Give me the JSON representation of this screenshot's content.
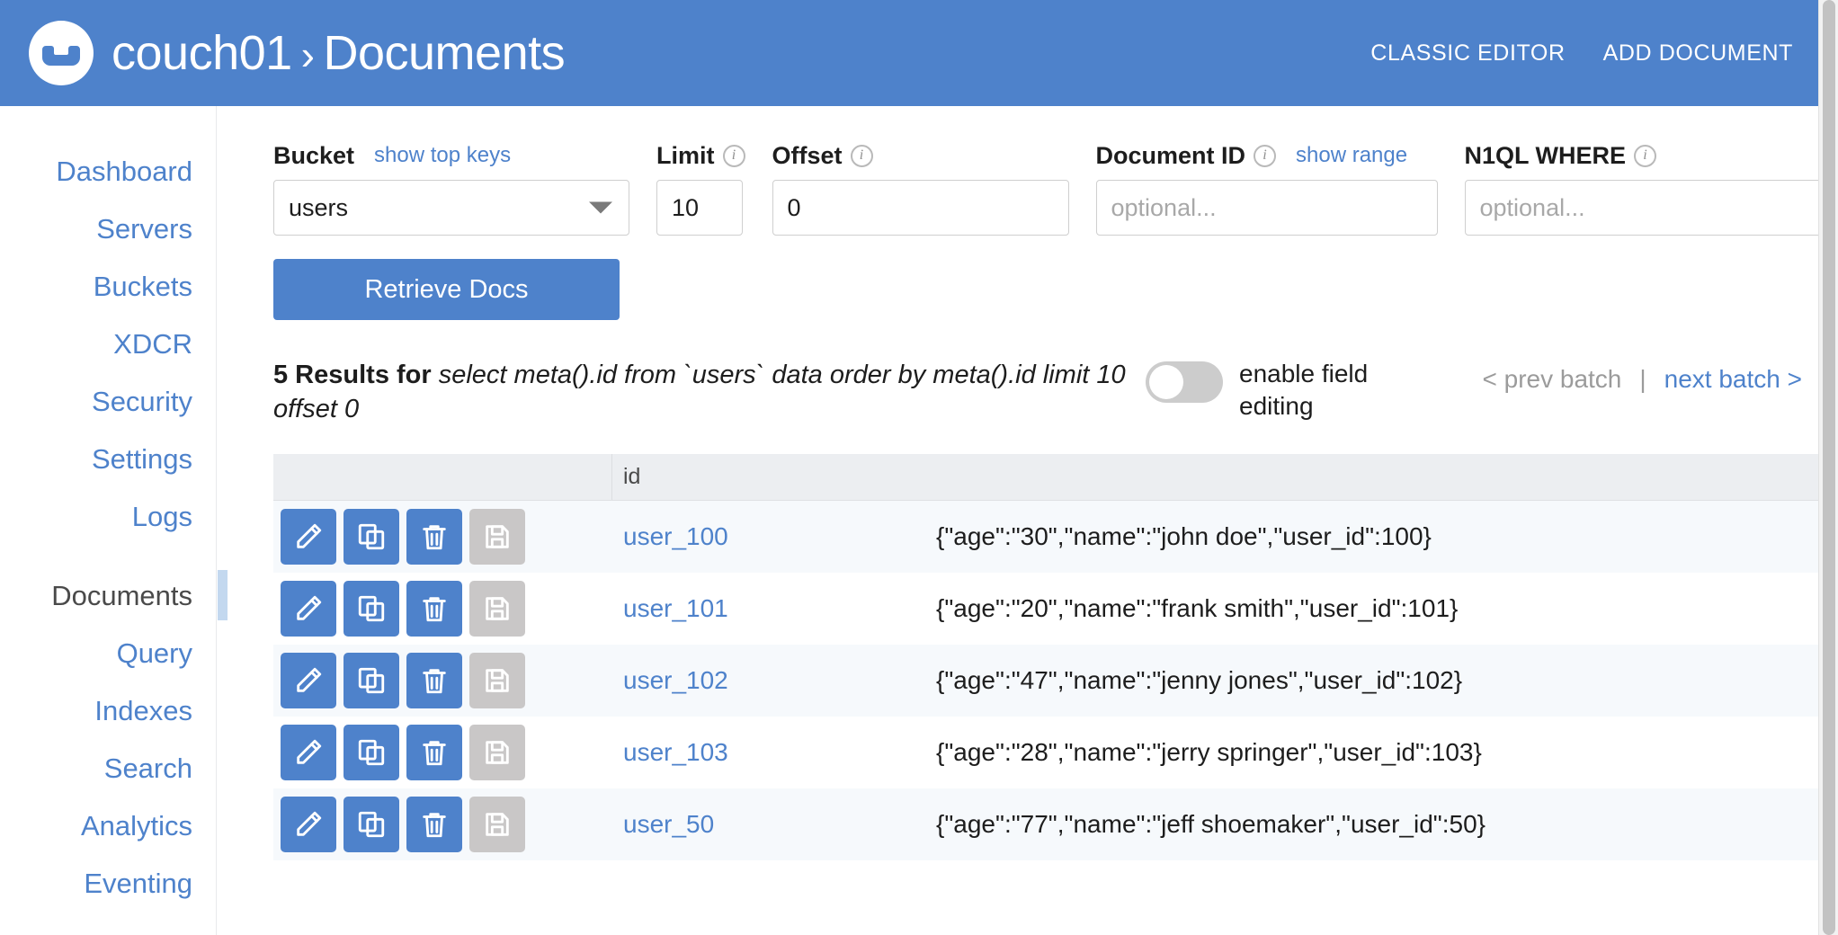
{
  "header": {
    "logo_icon": "couchbase-logo-icon",
    "cluster": "couch01",
    "separator": "›",
    "section": "Documents",
    "classic_editor_label": "CLASSIC EDITOR",
    "add_document_label": "ADD DOCUMENT",
    "background_color": "#4e82cb"
  },
  "sidebar": {
    "items": [
      {
        "label": "Dashboard",
        "active": false
      },
      {
        "label": "Servers",
        "active": false
      },
      {
        "label": "Buckets",
        "active": false
      },
      {
        "label": "XDCR",
        "active": false
      },
      {
        "label": "Security",
        "active": false
      },
      {
        "label": "Settings",
        "active": false
      },
      {
        "label": "Logs",
        "active": false
      },
      {
        "label": "Documents",
        "active": true
      },
      {
        "label": "Query",
        "active": false
      },
      {
        "label": "Indexes",
        "active": false
      },
      {
        "label": "Search",
        "active": false
      },
      {
        "label": "Analytics",
        "active": false
      },
      {
        "label": "Eventing",
        "active": false
      }
    ],
    "link_color": "#4e82cb",
    "active_color": "#4a4a4a",
    "active_marker_color": "#c3d8ef"
  },
  "filters": {
    "bucket": {
      "label": "Bucket",
      "value": "users",
      "show_top_keys_label": "show top keys"
    },
    "limit": {
      "label": "Limit",
      "value": "10",
      "info_icon": "info-icon"
    },
    "offset": {
      "label": "Offset",
      "value": "0",
      "info_icon": "info-icon"
    },
    "document_id": {
      "label": "Document ID",
      "value": "",
      "placeholder": "optional...",
      "show_range_label": "show range",
      "info_icon": "info-icon"
    },
    "n1ql_where": {
      "label": "N1QL WHERE",
      "value": "",
      "placeholder": "optional...",
      "info_icon": "info-icon"
    },
    "retrieve_docs_label": "Retrieve Docs"
  },
  "results": {
    "count_text": "5 Results for",
    "query_text": "select meta().id from `users` data order by meta().id limit 10 offset 0",
    "field_editing": {
      "label": "enable field editing",
      "enabled": false
    },
    "pagination": {
      "prev_label": "< prev batch",
      "divider": "|",
      "next_label": "next batch >",
      "prev_enabled": false,
      "next_enabled": true
    }
  },
  "table": {
    "columns": [
      "",
      "id"
    ],
    "row_actions": [
      {
        "icon": "pencil-icon",
        "name": "edit-document-button",
        "disabled": false
      },
      {
        "icon": "copy-icon",
        "name": "copy-document-button",
        "disabled": false
      },
      {
        "icon": "trash-icon",
        "name": "delete-document-button",
        "disabled": false
      },
      {
        "icon": "save-icon",
        "name": "save-document-button",
        "disabled": true
      }
    ],
    "rows": [
      {
        "id": "user_100",
        "doc": "{\"age\":\"30\",\"name\":\"john doe\",\"user_id\":100}"
      },
      {
        "id": "user_101",
        "doc": "{\"age\":\"20\",\"name\":\"frank smith\",\"user_id\":101}"
      },
      {
        "id": "user_102",
        "doc": "{\"age\":\"47\",\"name\":\"jenny jones\",\"user_id\":102}"
      },
      {
        "id": "user_103",
        "doc": "{\"age\":\"28\",\"name\":\"jerry springer\",\"user_id\":103}"
      },
      {
        "id": "user_50",
        "doc": "{\"age\":\"77\",\"name\":\"jeff shoemaker\",\"user_id\":50}"
      }
    ]
  },
  "scrollbar": {
    "name": "vertical-scrollbar"
  }
}
